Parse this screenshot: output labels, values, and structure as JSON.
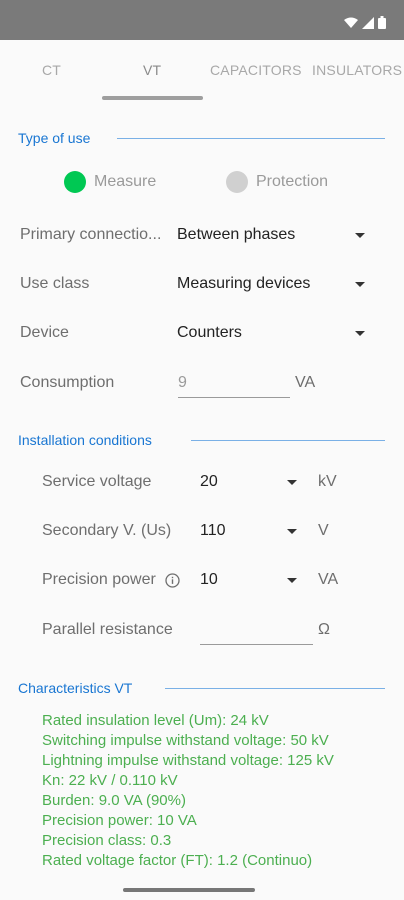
{
  "tabs": [
    {
      "label": "CT"
    },
    {
      "label": "VT"
    },
    {
      "label": "CAPACITORS"
    },
    {
      "label": "INSULATORS"
    }
  ],
  "type_of_use": {
    "title": "Type of use",
    "options": [
      {
        "label": "Measure",
        "selected": true,
        "color": "#00c853"
      },
      {
        "label": "Protection",
        "selected": false,
        "color": "#d0d0d0"
      }
    ]
  },
  "fields": {
    "primary_connection": {
      "label": "Primary connectio...",
      "value": "Between phases"
    },
    "use_class": {
      "label": "Use class",
      "value": "Measuring devices"
    },
    "device": {
      "label": "Device",
      "value": "Counters"
    },
    "consumption": {
      "label": "Consumption",
      "value": "9",
      "unit": "VA"
    }
  },
  "installation": {
    "title": "Installation conditions",
    "service_voltage": {
      "label": "Service voltage",
      "value": "20",
      "unit": "kV"
    },
    "secondary_voltage": {
      "label": "Secondary V. (Us)",
      "value": "110",
      "unit": "V"
    },
    "precision_power": {
      "label": "Precision power",
      "value": "10",
      "unit": "VA"
    },
    "parallel_resistance": {
      "label": "Parallel resistance",
      "value": "",
      "unit": "Ω"
    }
  },
  "characteristics": {
    "title": "Characteristics VT",
    "lines": [
      "Rated insulation level (Um): 24 kV",
      "Switching impulse withstand voltage: 50 kV",
      "Lightning impulse withstand voltage: 125 kV",
      "Kn: 22 kV / 0.110 kV",
      "Burden: 9.0 VA (90%)",
      "Precision power: 10 VA",
      "Precision class: 0.3",
      "Rated voltage factor (FT): 1.2 (Continuo)"
    ]
  },
  "colors": {
    "accent": "#1976d2",
    "result_text": "#4caf50",
    "status_bar": "#7a7a7a"
  }
}
